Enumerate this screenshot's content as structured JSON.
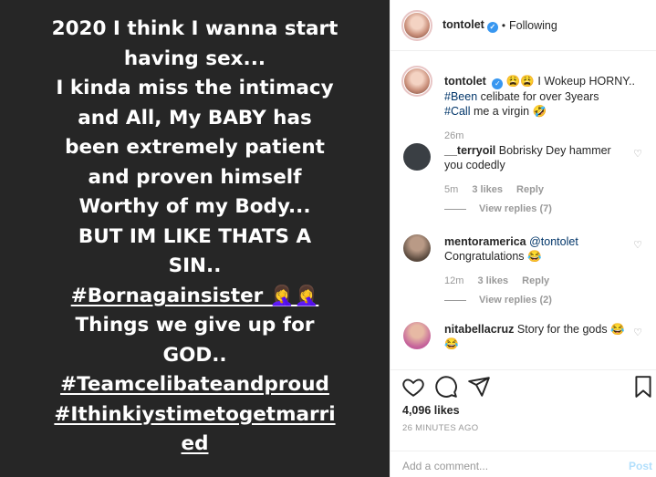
{
  "story": {
    "lines": [
      "2020 I think I wanna start",
      "having sex...",
      "I kinda miss the intimacy",
      "and All, My BABY has",
      "been extremely patient",
      "and proven himself",
      "Worthy of my Body...",
      "BUT IM LIKE THATS A",
      "SIN..",
      "#Bornagainsister 🤦‍♀️🤦‍♀️",
      "Things we give up for",
      "GOD..",
      "#Teamcelibateandproud",
      "#Ithinkiystimetogetmarri",
      "ed"
    ]
  },
  "header": {
    "username": "tontolet",
    "separator": "•",
    "follow_status": "Following",
    "verified_icon": "verified-badge-icon"
  },
  "caption": {
    "username": "tontolet",
    "emojis": "😩😩",
    "text1": "I Wokeup HORNY..",
    "tag1": "#Been",
    "text2": " celibate for over 3years",
    "tag2": "#Call",
    "text3": " me a virgin 🤣",
    "time": "26m"
  },
  "comments": [
    {
      "username": "__terryoil",
      "text": "Bobrisky Dey hammer you codedly",
      "time": "5m",
      "likes": "3 likes",
      "reply": "Reply",
      "view_replies": "View replies (7)",
      "avatar_color": "#3a3f44"
    },
    {
      "username": "mentoramerica",
      "mention": "@tontolet",
      "text": "Congratulations 😂",
      "time": "12m",
      "likes": "3 likes",
      "reply": "Reply",
      "view_replies": "View replies (2)",
      "avatar_color": "#5a4a3e"
    },
    {
      "username": "nitabellacruz",
      "text": "Story for the gods 😂 😂",
      "avatar_color": "#c4609a"
    }
  ],
  "actions": {
    "likes": "4,096 likes",
    "time_ago": "26 MINUTES AGO",
    "placeholder": "Add a comment...",
    "post_label": "Post"
  }
}
